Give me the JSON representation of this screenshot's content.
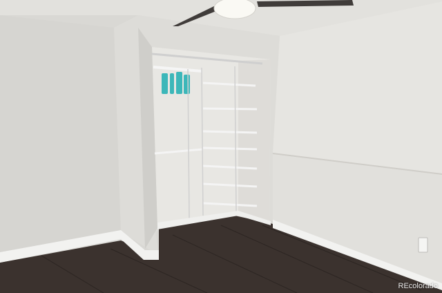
{
  "watermark": {
    "text": "REcolorado"
  },
  "colors": {
    "ceiling": "#e3e2df",
    "left_wall": "#d8d7d3",
    "right_wall": "#e4e3df",
    "closet_wall": "#dcdbd7",
    "closet_interior": "#e9e8e4",
    "floor": "#3d3430",
    "baseboard": "#f3f3f1",
    "shelf": "#f4f4f4",
    "hangers": "#3bb6b8",
    "fan_blade": "#3f3b39",
    "fan_light": "#f8f7f2"
  }
}
